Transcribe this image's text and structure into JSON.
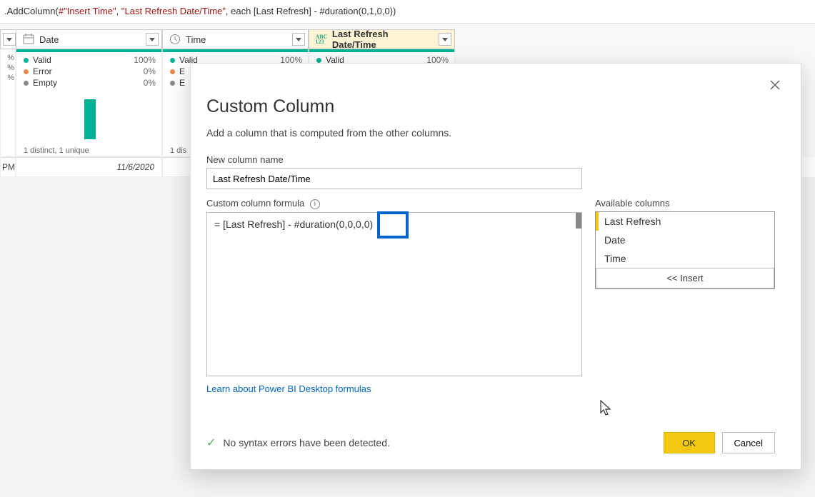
{
  "formula_bar": {
    "prefix": ".AddColumn(",
    "arg1": "#\"Insert Time\"",
    "arg2": "\"Last Refresh Date/Time\"",
    "tail": ", each [Last Refresh] - #duration(0,1,0,0))"
  },
  "columns": {
    "c0": {
      "name": "Date",
      "stats": {
        "valid": "100%",
        "error": "0%",
        "empty": "0%"
      },
      "distinct": "1 distinct, 1 unique"
    },
    "c1": {
      "name": "Time",
      "stats_label_valid": "Valid",
      "stats_pct_valid": "100%",
      "truncE1": "E",
      "truncE2": "E",
      "distinct": "1 dis"
    },
    "c2": {
      "name": "Last Refresh Date/Time",
      "stats_label_valid": "Valid",
      "stats_pct_valid": "100%"
    },
    "labels": {
      "valid": "Valid",
      "error": "Error",
      "empty": "Empty"
    }
  },
  "first_col_pcts": {
    "a": "%",
    "b": "%",
    "c": "%"
  },
  "row": {
    "pm": "PM",
    "date": "11/6/2020"
  },
  "dialog": {
    "title": "Custom Column",
    "subtitle": "Add a column that is computed from the other columns.",
    "name_label": "New column name",
    "name_value": "Last Refresh Date/Time",
    "formula_label": "Custom column formula",
    "formula_value": "= [Last Refresh] - #duration(0,0,0,0)",
    "available_label": "Available columns",
    "available": [
      "Last Refresh",
      "Date",
      "Time"
    ],
    "insert_label": "<< Insert",
    "link": "Learn about Power BI Desktop formulas",
    "syntax_msg": "No syntax errors have been detected.",
    "ok": "OK",
    "cancel": "Cancel"
  }
}
